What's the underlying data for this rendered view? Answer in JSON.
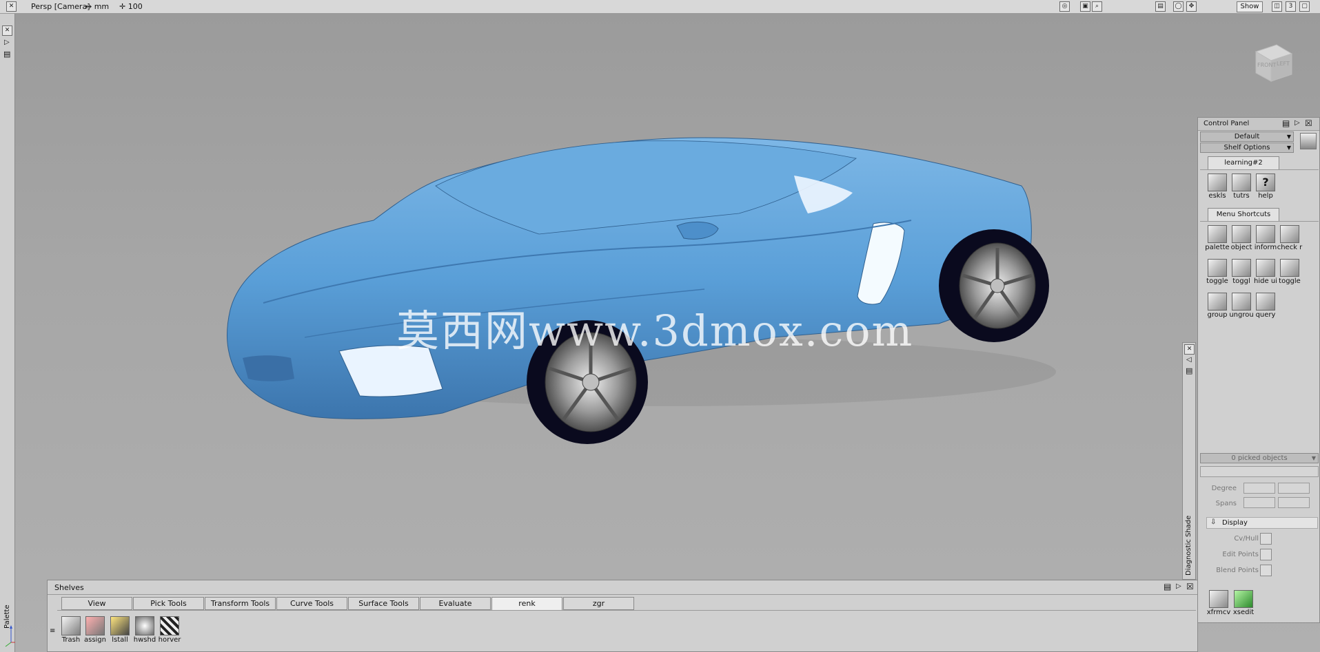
{
  "topbar": {
    "camera_label": "Persp [Camera]",
    "unit_label": "mm",
    "zoom_value": "100",
    "show_button": "Show",
    "layout_number": "3"
  },
  "viewcube": {
    "front": "FRONT",
    "left": "LEFT"
  },
  "watermark": "莫西网www.3dmox.com",
  "left_strip": {
    "palette_label": "Palette"
  },
  "control_panel": {
    "title": "Control Panel",
    "default_dropdown": "Default",
    "shelf_options": "Shelf Options",
    "tabs": [
      {
        "label": "learning#2"
      },
      {
        "label": "Menu Shortcuts"
      }
    ],
    "learning_tools": [
      {
        "label": "eskls",
        "icon": "skills-icon"
      },
      {
        "label": "tutrs",
        "icon": "tutorials-icon"
      },
      {
        "label": "help",
        "icon": "help-icon"
      }
    ],
    "shortcut_tools": [
      {
        "label": "palette",
        "icon": "palette-icon"
      },
      {
        "label": "object",
        "icon": "object-icon"
      },
      {
        "label": "inform",
        "icon": "info-icon"
      },
      {
        "label": "check r",
        "icon": "check-icon"
      },
      {
        "label": "toggle",
        "icon": "toggle-icon"
      },
      {
        "label": "toggl",
        "icon": "toggle-icon"
      },
      {
        "label": "hide ui",
        "icon": "hide-ui-icon"
      },
      {
        "label": "toggle",
        "icon": "toggle-grid-icon"
      },
      {
        "label": "group",
        "icon": "group-icon"
      },
      {
        "label": "ungrou",
        "icon": "ungroup-icon"
      },
      {
        "label": "query",
        "icon": "query-icon"
      }
    ],
    "picked_objects": "0 picked objects",
    "degree_label": "Degree",
    "spans_label": "Spans",
    "display_section": "Display",
    "display_options": [
      "Cv/Hull",
      "Edit Points",
      "Blend Points"
    ],
    "bottom_tools": [
      {
        "label": "xfrmcv",
        "icon": "transform-cv-icon"
      },
      {
        "label": "xsedit",
        "icon": "xsedit-icon"
      }
    ]
  },
  "diagnostic_shade": "Diagnostic Shade",
  "shelves": {
    "title": "Shelves",
    "tabs": [
      "View",
      "Pick Tools",
      "Transform Tools",
      "Curve Tools",
      "Surface Tools",
      "Evaluate",
      "renk",
      "zgr"
    ],
    "active_tab": "renk",
    "tools": [
      {
        "label": "Trash",
        "icon": "trash-icon"
      },
      {
        "label": "assign",
        "icon": "assign-icon"
      },
      {
        "label": "lstall",
        "icon": "list-all-icon"
      },
      {
        "label": "hwshd",
        "icon": "hardware-shade-icon"
      },
      {
        "label": "horver",
        "icon": "horizontal-vertical-icon"
      }
    ]
  },
  "colors": {
    "car_body": "#5a9fd8",
    "car_shadow": "#3c75ad",
    "viewport_bg": "#a5a5a5",
    "panel_bg": "#d0d0d0"
  }
}
